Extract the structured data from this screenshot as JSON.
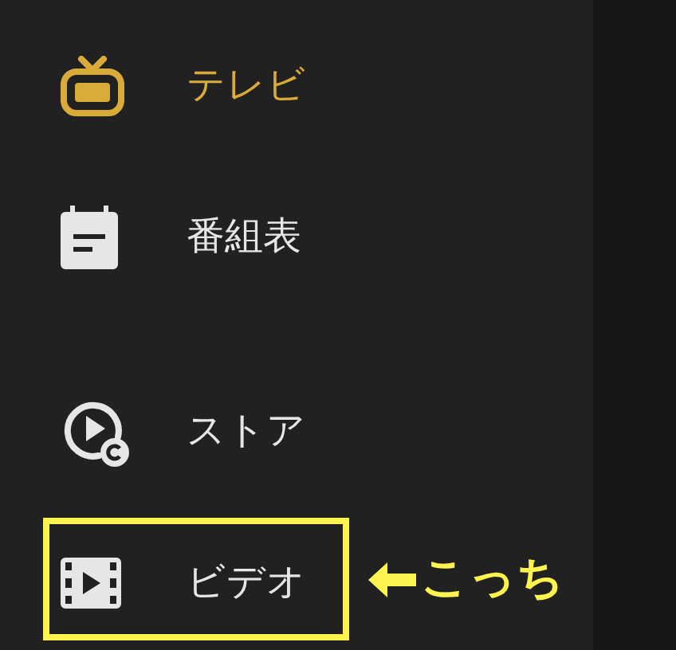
{
  "menu": {
    "groups": [
      {
        "items": [
          {
            "kind": "tv",
            "label": "テレビ",
            "selected": true,
            "highlighted": false
          },
          {
            "kind": "guide",
            "label": "番組表",
            "selected": false,
            "highlighted": false
          }
        ]
      },
      {
        "items": [
          {
            "kind": "store",
            "label": "ストア",
            "selected": false,
            "highlighted": false
          },
          {
            "kind": "video",
            "label": "ビデオ",
            "selected": false,
            "highlighted": true
          }
        ]
      }
    ]
  },
  "annotation": {
    "text": "こっち"
  }
}
